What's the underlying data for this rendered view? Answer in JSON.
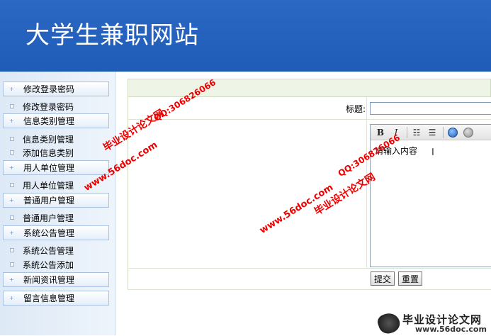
{
  "header": {
    "title": "大学生兼职网站"
  },
  "sidebar": {
    "groups": [
      {
        "label": "修改登录密码",
        "items": [
          "修改登录密码"
        ]
      },
      {
        "label": "信息类别管理",
        "items": [
          "信息类别管理",
          "添加信息类别"
        ]
      },
      {
        "label": "用人单位管理",
        "items": [
          "用人单位管理"
        ]
      },
      {
        "label": "普通用户管理",
        "items": [
          "普通用户管理"
        ]
      },
      {
        "label": "系统公告管理",
        "items": [
          "系统公告管理",
          "系统公告添加"
        ]
      },
      {
        "label": "新闻资讯管理",
        "items": []
      },
      {
        "label": "留言信息管理",
        "items": []
      }
    ]
  },
  "form": {
    "title_label": "标题:",
    "title_value": "",
    "content_text": "请输入内容",
    "submit_label": "提交",
    "reset_label": "重置"
  },
  "editor": {
    "toolbar": [
      "bold-icon",
      "italic-icon",
      "ordered-list-icon",
      "unordered-list-icon",
      "globe-link-icon",
      "image-icon"
    ]
  },
  "watermarks": {
    "brand": "毕业设计论文网",
    "qq": "QQ:306826066",
    "site": "www.56doc.com"
  },
  "footer_logo": {
    "brand": "毕业设计论文网",
    "url": "www.56doc.com"
  },
  "colors": {
    "header": "#1f5cb8",
    "watermark": "#ee0000"
  }
}
